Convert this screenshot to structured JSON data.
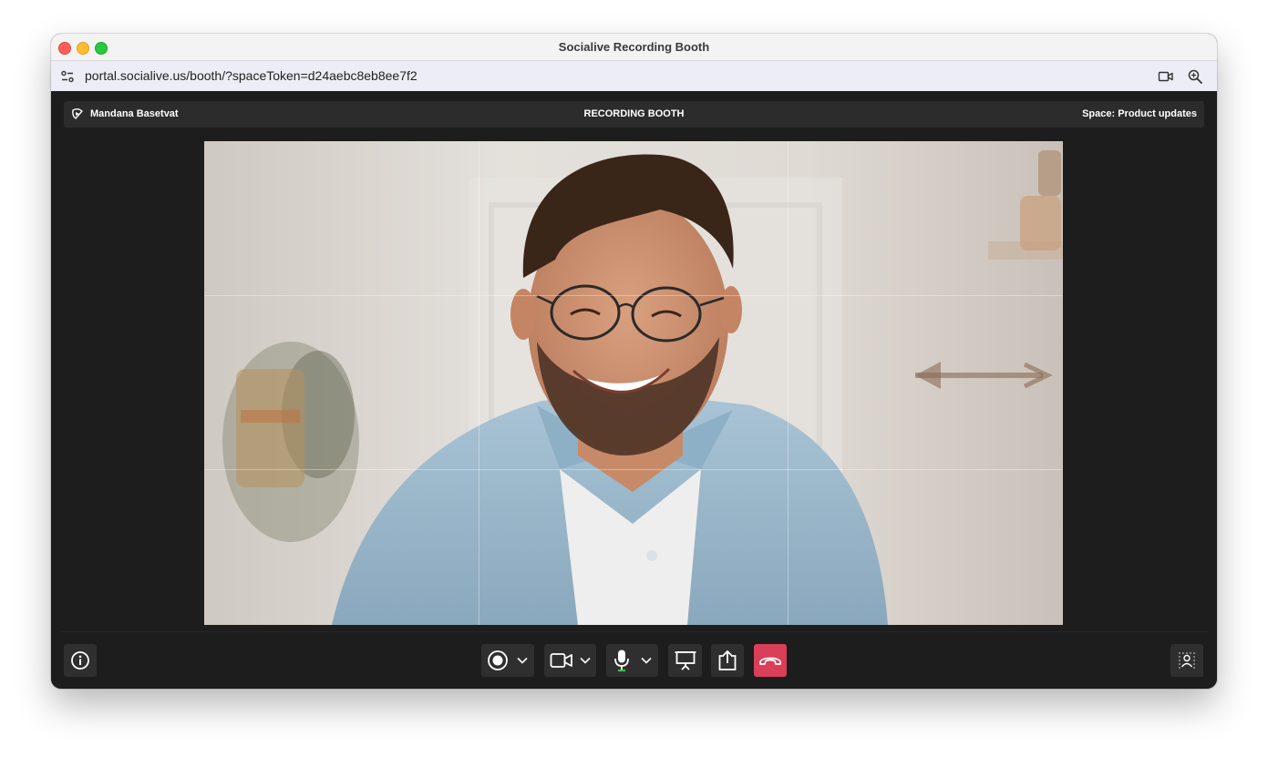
{
  "window": {
    "title": "Socialive Recording Booth"
  },
  "browser": {
    "url": "portal.socialive.us/booth/?spaceToken=d24aebc8eb8ee7f2",
    "icons": [
      "site-settings-icon",
      "camera-icon",
      "zoom-icon"
    ]
  },
  "app": {
    "user_name": "Mandana Basetvat",
    "section_title": "RECORDING BOOTH",
    "space_label": "Space: Product updates"
  },
  "toolbar": {
    "buttons": [
      {
        "name": "info",
        "icon": "info-icon"
      },
      {
        "name": "record",
        "icon": "record-icon",
        "has_dropdown": true
      },
      {
        "name": "camera",
        "icon": "video-camera-icon",
        "has_dropdown": true
      },
      {
        "name": "microphone",
        "icon": "microphone-icon",
        "has_dropdown": true
      },
      {
        "name": "present",
        "icon": "presentation-icon"
      },
      {
        "name": "share",
        "icon": "share-icon"
      },
      {
        "name": "end-call",
        "icon": "hang-up-icon"
      },
      {
        "name": "background-effects",
        "icon": "background-blur-icon"
      }
    ]
  },
  "colors": {
    "end_call": "#d93f58",
    "app_background": "#1d1d1d",
    "mic_active": "#3fbf4a"
  }
}
